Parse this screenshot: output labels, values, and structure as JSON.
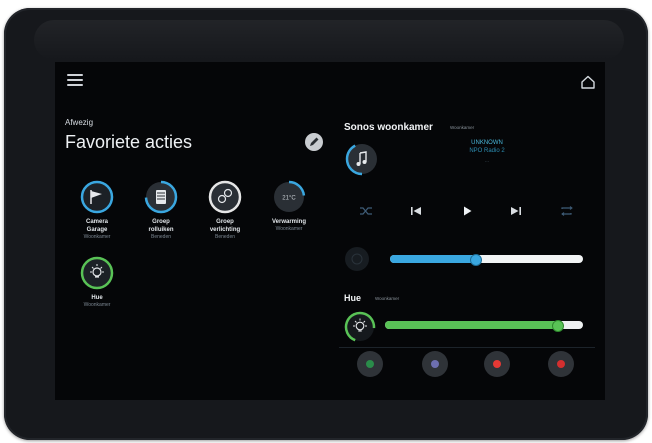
{
  "header": {
    "menu_icon": "hamburger-menu-icon",
    "home_icon": "home-icon"
  },
  "presence": {
    "status": "Afwezig"
  },
  "favorites": {
    "title": "Favoriete acties",
    "edit_icon": "pencil-icon",
    "tiles": [
      {
        "name": "Camera",
        "name2": "Garage",
        "sub": "Woonkamer",
        "icon": "camera-icon",
        "accent": "#3aa7e0"
      },
      {
        "name": "Groep",
        "name2": "rolluiken",
        "sub": "Beneden",
        "icon": "blinds-icon",
        "accent": "#3aa7e0"
      },
      {
        "name": "Groep",
        "name2": "verlichting",
        "sub": "Beneden",
        "icon": "lights-icon",
        "accent": "#e6e6e6"
      },
      {
        "name": "Verwarming",
        "name2": "",
        "sub": "Woonkamer",
        "icon": "thermostat-icon",
        "value": "21°C",
        "accent": "#3aa7e0"
      },
      {
        "name": "Hue",
        "name2": "",
        "sub": "Woonkamer",
        "icon": "bulb-icon",
        "accent": "#59c256"
      }
    ]
  },
  "sonos": {
    "title": "Sonos woonkamer",
    "room": "Woonkamer",
    "source_icon": "music-note-icon",
    "track_title": "UNKNOWN",
    "track_station": "NPO Radio 2",
    "track_extra": "...",
    "controls": [
      "shuffle-icon",
      "previous-icon",
      "play-icon",
      "next-icon",
      "repeat-icon"
    ],
    "volume_level": 0.44,
    "accent": "#3aa7e0"
  },
  "hue": {
    "title": "Hue",
    "room": "Woonkamer",
    "brightness_level": 0.87,
    "accent": "#59c256",
    "scenes": [
      "#2a8c4a",
      "#6d6fb0",
      "#e53935",
      "#d32f2f"
    ]
  }
}
